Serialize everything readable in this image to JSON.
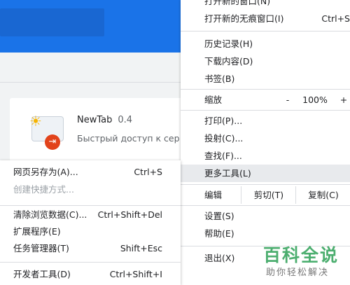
{
  "background": {
    "extension": {
      "name": "NewTab",
      "version": "0.4",
      "description": "Быстрый доступ к сер"
    }
  },
  "main_menu": {
    "items_top": [
      {
        "label": "打开新的窗口(N)",
        "shortcut": ""
      },
      {
        "label": "打开新的无痕窗口(I)",
        "shortcut": "Ctrl+S"
      }
    ],
    "items_history": [
      {
        "label": "历史记录(H)"
      },
      {
        "label": "下载内容(D)"
      },
      {
        "label": "书签(B)"
      }
    ],
    "zoom": {
      "label": "缩放",
      "minus": "-",
      "value": "100%",
      "plus": "+"
    },
    "items_print": [
      {
        "label": "打印(P)..."
      },
      {
        "label": "投射(C)..."
      },
      {
        "label": "查找(F)..."
      },
      {
        "label": "更多工具(L)"
      }
    ],
    "edit": {
      "label": "编辑",
      "cut": "剪切(T)",
      "copy": "复制(C)"
    },
    "items_settings": [
      {
        "label": "设置(S)"
      },
      {
        "label": "帮助(E)"
      }
    ],
    "exit": {
      "label": "退出(X)"
    }
  },
  "sub_menu": {
    "items": [
      {
        "label": "网页另存为(A)...",
        "shortcut": "Ctrl+S"
      },
      {
        "label": "创建快捷方式...",
        "shortcut": ""
      },
      {
        "label": "清除浏览数据(C)...",
        "shortcut": "Ctrl+Shift+Del"
      },
      {
        "label": "扩展程序(E)",
        "shortcut": ""
      },
      {
        "label": "任务管理器(T)",
        "shortcut": "Shift+Esc"
      },
      {
        "label": "开发者工具(D)",
        "shortcut": "Ctrl+Shift+I"
      }
    ]
  },
  "watermark": {
    "title": "百科全说",
    "subtitle": "助你轻松解决"
  }
}
